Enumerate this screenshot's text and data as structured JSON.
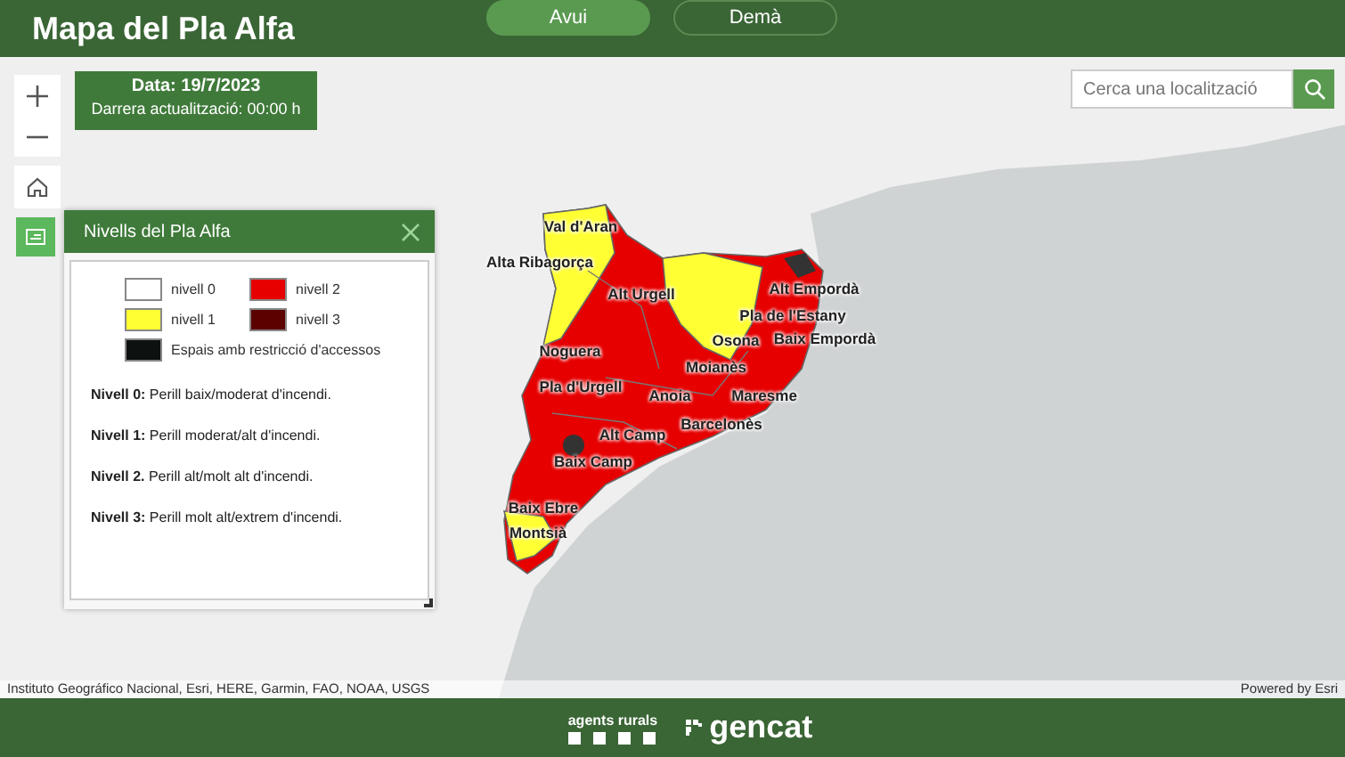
{
  "header": {
    "title": "Mapa del Pla Alfa",
    "tabs": [
      {
        "label": "Avui",
        "selected": true
      },
      {
        "label": "Demà",
        "selected": false
      }
    ]
  },
  "date_card": {
    "date": "Data: 19/7/2023",
    "updated": "Darrera actualització: 00:00 h"
  },
  "search": {
    "placeholder": "Cerca una localització"
  },
  "legend_panel": {
    "title": "Nivells del Pla Alfa",
    "items": [
      {
        "label": "nivell 0",
        "color": "#ffffff"
      },
      {
        "label": "nivell 2",
        "color": "#e60000"
      },
      {
        "label": "nivell 1",
        "color": "#ffff33"
      },
      {
        "label": "nivell 3",
        "color": "#5c0000"
      },
      {
        "label": "Espais amb restricció d'accessos",
        "color": "#0d1210"
      }
    ],
    "descriptions": [
      "**Nivell 0:** Perill baix/moderat d'incendi.",
      "**Nivell 1:** Perill moderat/alt d'incendi.",
      "**Nivell 2.** Perill alt/molt alt d'incendi.",
      "**Nivell 3:** Perill molt alt/extrem d'incendi."
    ]
  },
  "map": {
    "labels": [
      "Val d'Aran",
      "Alta Ribagorça",
      "Alt Urgell",
      "Alt Empordà",
      "Pla de l'Estany",
      "Osona",
      "Baix Empordà",
      "Noguera",
      "Moianès",
      "Pla d'Urgell",
      "Anoia",
      "Maresme",
      "Barcelonès",
      "Alt Camp",
      "Baix Camp",
      "Baix Ebre",
      "Montsià"
    ]
  },
  "attribution": {
    "sources": "Instituto Geográfico Nacional, Esri, HERE, Garmin, FAO, NOAA, USGS",
    "powered": "Powered by Esri"
  },
  "footer": {
    "brand": "agents rurals",
    "logo": "gencat"
  }
}
